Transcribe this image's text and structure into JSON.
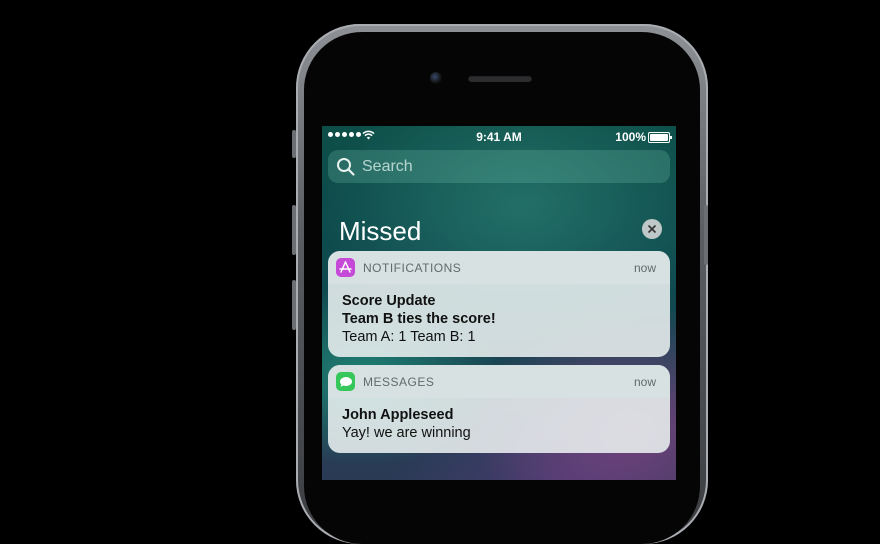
{
  "status_bar": {
    "time": "9:41 AM",
    "battery": "100%",
    "signal_icon": "signal-dots-icon",
    "wifi_icon": "wifi-icon"
  },
  "search": {
    "placeholder": "Search",
    "icon": "search-icon"
  },
  "section": {
    "title": "Missed",
    "clear_icon": "close-icon"
  },
  "notifications": [
    {
      "app": "NOTIFICATIONS",
      "time": "now",
      "icon": "app-store-icon",
      "icon_color": "#c54ad8",
      "title": "Score Update",
      "subtitle": "Team B ties the score!",
      "message": "Team A: 1 Team B: 1"
    },
    {
      "app": "MESSAGES",
      "time": "now",
      "icon": "messages-icon",
      "icon_color": "#35c759",
      "title": "John Appleseed",
      "message": "Yay! we are winning"
    }
  ]
}
